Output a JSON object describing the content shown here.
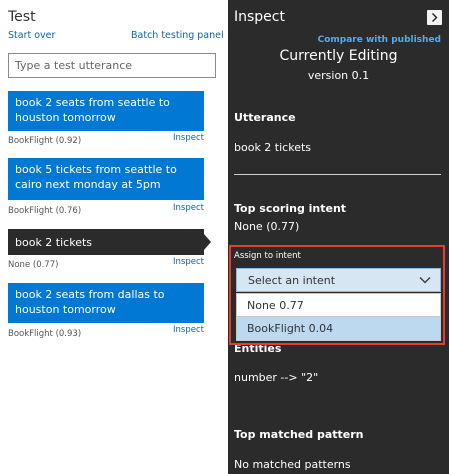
{
  "test_panel": {
    "title": "Test",
    "start_over": "Start over",
    "batch_panel": "Batch testing panel",
    "input_placeholder": "Type a test utterance",
    "utterances": [
      {
        "text": "book 2 seats from seattle to houston tomorrow",
        "result": "BookFlight (0.92)",
        "inspect": "Inspect"
      },
      {
        "text": "book 5 tickets from seattle to cairo next monday at 5pm",
        "result": "BookFlight (0.76)",
        "inspect": "Inspect"
      },
      {
        "text": "book 2 tickets",
        "result": "None (0.77)",
        "inspect": "Inspect"
      },
      {
        "text": "book 2 seats from dallas to houston tomorrow",
        "result": "BookFlight (0.93)",
        "inspect": "Inspect"
      }
    ]
  },
  "inspect_panel": {
    "title": "Inspect",
    "compare": "Compare with published",
    "currently_editing": "Currently Editing",
    "version": "version 0.1",
    "utterance_heading": "Utterance",
    "utterance_value": "book 2 tickets",
    "top_intent_heading": "Top scoring intent",
    "top_intent_value": "None (0.77)",
    "assign_label": "Assign to intent",
    "select_placeholder": "Select an intent",
    "options": [
      "None 0.77",
      "BookFlight 0.04"
    ],
    "entities_heading": "Entities",
    "entities_value": "number --> \"2\"",
    "pattern_heading": "Top matched pattern",
    "pattern_value": "No matched patterns"
  },
  "colors": {
    "accent_blue": "#0078d4",
    "dark_panel": "#2b2b2b",
    "highlight_red": "#e0412f",
    "link_blue": "#0a64b4"
  },
  "icons": {
    "close": "chevron-right-icon",
    "dropdown": "chevron-down-icon"
  }
}
